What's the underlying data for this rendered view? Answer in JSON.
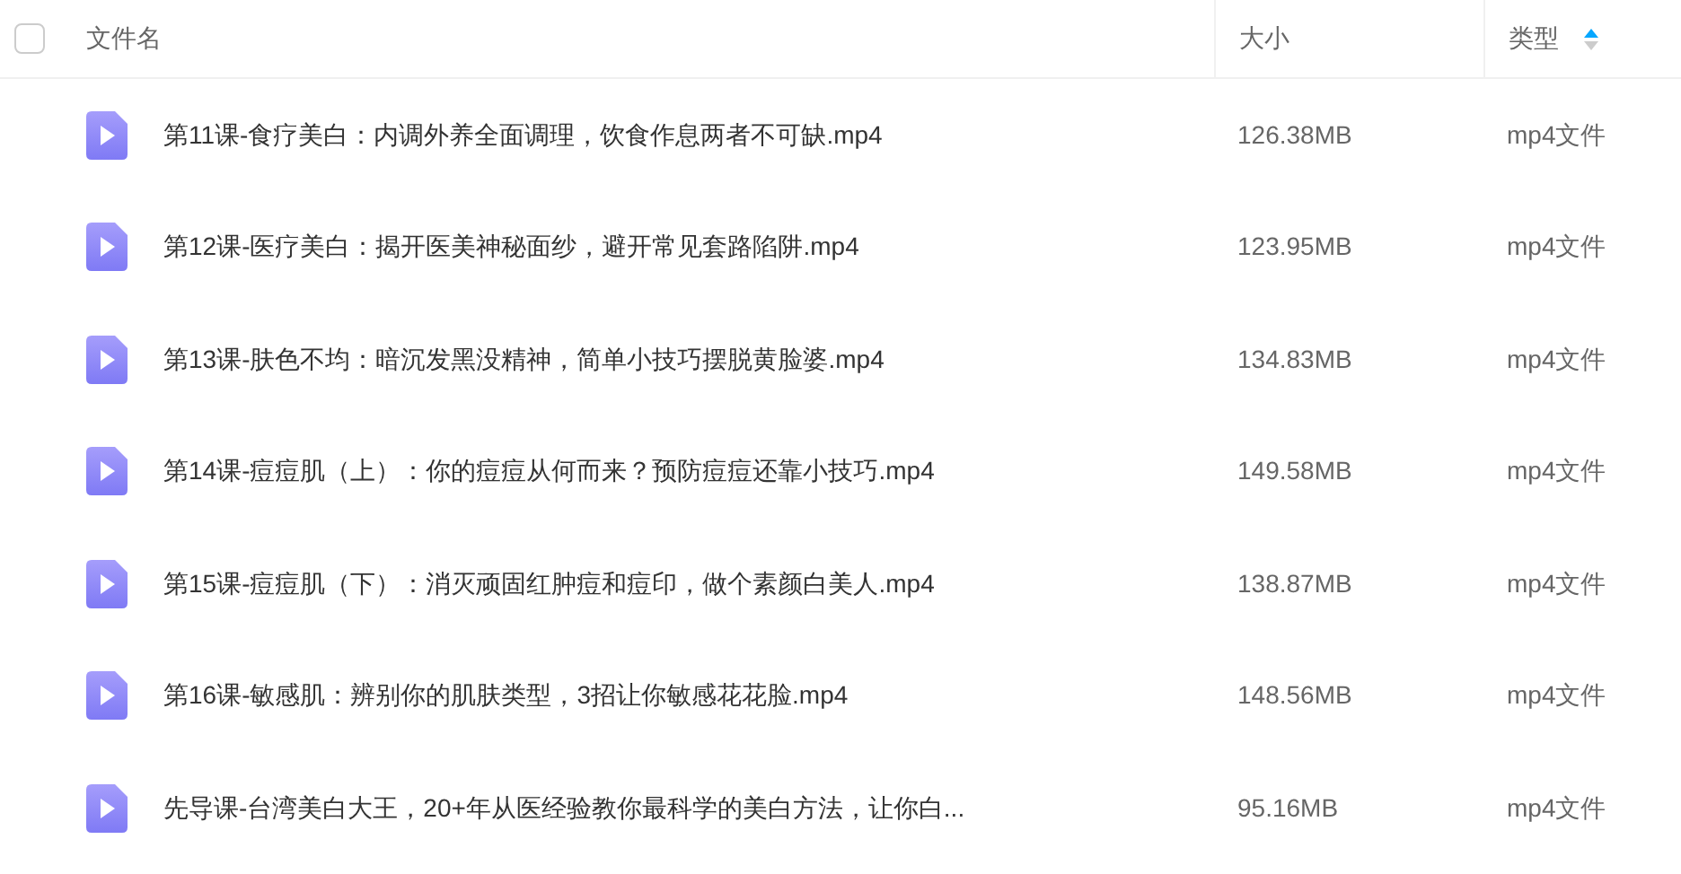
{
  "table": {
    "select_all": {
      "checked": false
    },
    "columns": [
      {
        "label": "文件名",
        "sorted": false
      },
      {
        "label": "大小",
        "sorted": false
      },
      {
        "label": "类型",
        "sorted": true
      }
    ],
    "rows": [
      {
        "name": "第11课-食疗美白：内调外养全面调理，饮食作息两者不可缺.mp4",
        "size": "126.38MB",
        "type": "mp4文件"
      },
      {
        "name": "第12课-医疗美白：揭开医美神秘面纱，避开常见套路陷阱.mp4",
        "size": "123.95MB",
        "type": "mp4文件"
      },
      {
        "name": "第13课-肤色不均：暗沉发黑没精神，简单小技巧摆脱黄脸婆.mp4",
        "size": "134.83MB",
        "type": "mp4文件"
      },
      {
        "name": "第14课-痘痘肌（上）：你的痘痘从何而来？预防痘痘还靠小技巧.mp4",
        "size": "149.58MB",
        "type": "mp4文件"
      },
      {
        "name": "第15课-痘痘肌（下）：消灭顽固红肿痘和痘印，做个素颜白美人.mp4",
        "size": "138.87MB",
        "type": "mp4文件"
      },
      {
        "name": "第16课-敏感肌：辨别你的肌肤类型，3招让你敏感花花脸.mp4",
        "size": "148.56MB",
        "type": "mp4文件"
      },
      {
        "name": "先导课-台湾美白大王，20+年从医经验教你最科学的美白方法，让你白...",
        "size": "95.16MB",
        "type": "mp4文件"
      }
    ]
  }
}
